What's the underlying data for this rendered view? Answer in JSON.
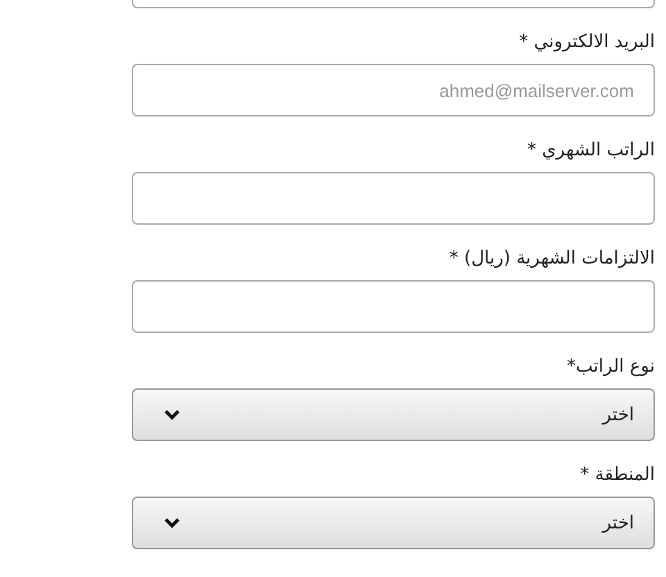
{
  "fields": [
    {
      "kind": "input",
      "label": "البريد الالكتروني *",
      "placeholder": "ahmed@mailserver.com"
    },
    {
      "kind": "input",
      "label": "الراتب الشهري *"
    },
    {
      "kind": "input",
      "label": "الالتزامات الشهرية (ريال) *"
    },
    {
      "kind": "select",
      "label": "نوع الراتب*",
      "value": "اختر"
    },
    {
      "kind": "select",
      "label": "المنطقة *",
      "value": "اختر"
    }
  ]
}
